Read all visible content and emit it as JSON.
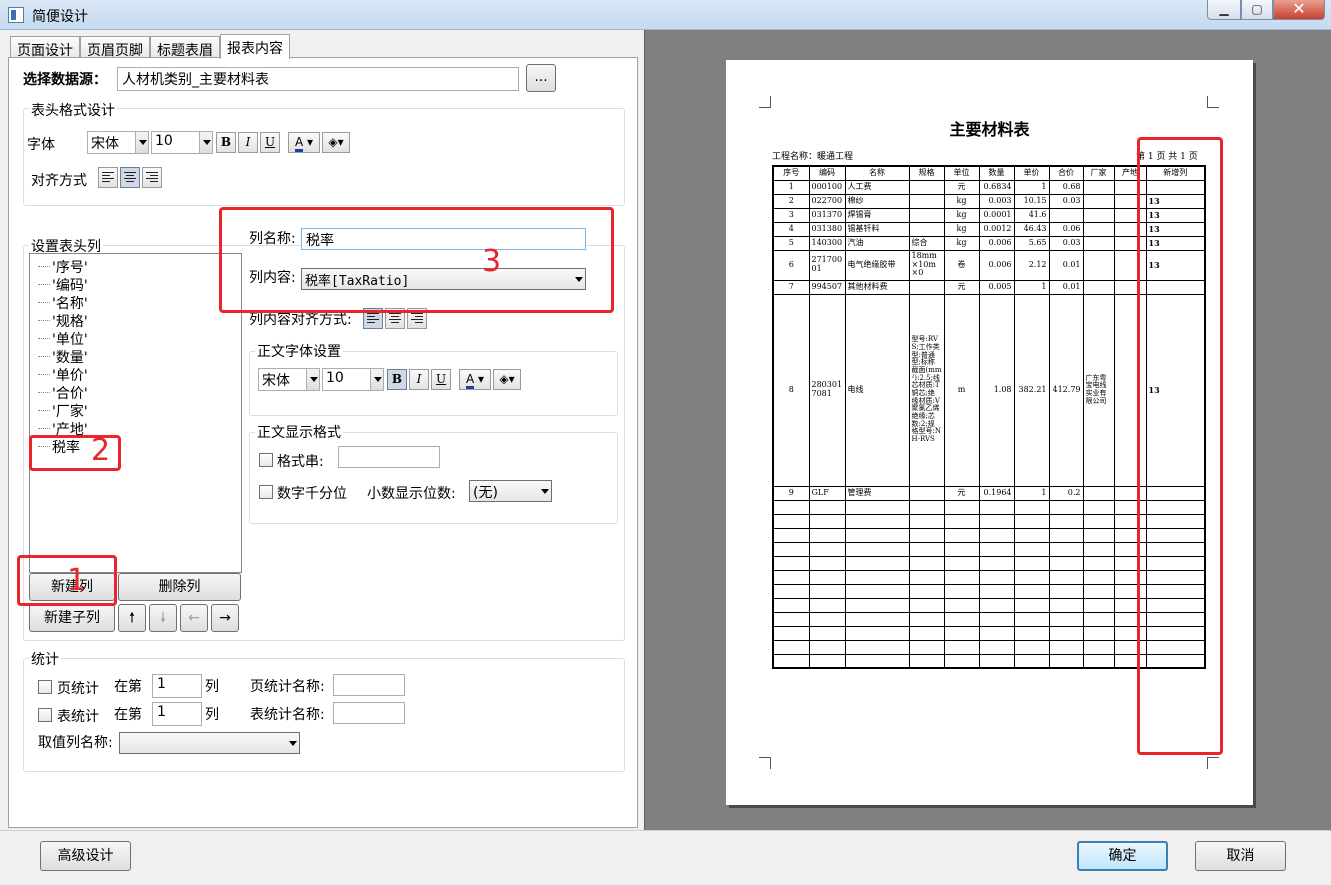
{
  "window": {
    "title": "简便设计",
    "close_glyph": "✕",
    "min_glyph": "▁",
    "max_glyph": "▢"
  },
  "tabs": [
    "页面设计",
    "页眉页脚",
    "标题表眉",
    "报表内容"
  ],
  "datasource": {
    "label": "选择数据源：",
    "value": "人材机类别_主要材料表",
    "browse": "..."
  },
  "header_format": {
    "title": "表头格式设计",
    "font_label": "字体",
    "font": "宋体",
    "size": "10",
    "align_label": "对齐方式"
  },
  "columns": {
    "title": "设置表头列",
    "items": [
      "'序号'",
      "'编码'",
      "'名称'",
      "'规格'",
      "'单位'",
      "'数量'",
      "'单价'",
      "'合价'",
      "'厂家'",
      "'产地'",
      "税率"
    ],
    "new_col": "新建列",
    "delete_col": "删除列",
    "new_sub_col": "新建子列",
    "up": "🠕",
    "down": "🠗",
    "left": "←",
    "right": "→"
  },
  "column_props": {
    "name_label": "列名称:",
    "name_value": "税率",
    "content_label": "列内容:",
    "content_value": "税率[TaxRatio]",
    "align_label": "列内容对齐方式:"
  },
  "body_font": {
    "title": "正文字体设置",
    "font": "宋体",
    "size": "10"
  },
  "body_format": {
    "title": "正文显示格式",
    "fmt_label": "格式串:",
    "thousand_label": "数字千分位",
    "decimals_label": "小数显示位数:",
    "decimals_value": "(无)"
  },
  "stats": {
    "title": "统计",
    "page_stat": "页统计",
    "table_stat": "表统计",
    "at_col": "在第",
    "col_unit": "列",
    "page_col": "1",
    "table_col": "1",
    "page_name_label": "页统计名称:",
    "table_name_label": "表统计名称:",
    "value_col_label": "取值列名称:"
  },
  "annotations": {
    "n1": "1",
    "n2": "2",
    "n3": "3"
  },
  "buttons": {
    "advanced": "高级设计",
    "ok": "确定",
    "cancel": "取消"
  },
  "report": {
    "title": "主要材料表",
    "project": "工程名称：暖通工程",
    "page": "第 1 页  共 1 页",
    "headers": [
      "序号",
      "编码",
      "名称",
      "规格",
      "单位",
      "数量",
      "单价",
      "合价",
      "厂家",
      "产地",
      "新增列"
    ],
    "rows": [
      [
        "1",
        "000100",
        "人工费",
        "",
        "元",
        "0.6834",
        "1",
        "0.68",
        "",
        "",
        ""
      ],
      [
        "2",
        "022700",
        "棉纱",
        "",
        "kg",
        "0.003",
        "10.15",
        "0.03",
        "",
        "",
        "13"
      ],
      [
        "3",
        "031370",
        "焊锡膏",
        "",
        "kg",
        "0.0001",
        "41.6",
        "",
        "",
        "",
        "13"
      ],
      [
        "4",
        "031380",
        "锡基钎料",
        "",
        "kg",
        "0.0012",
        "46.43",
        "0.06",
        "",
        "",
        "13"
      ],
      [
        "5",
        "140300",
        "汽油",
        "综合",
        "kg",
        "0.006",
        "5.65",
        "0.03",
        "",
        "",
        "13"
      ],
      [
        "6",
        "27170001",
        "电气绝缘胶带",
        "18mm×10m×0",
        "卷",
        "0.006",
        "2.12",
        "0.01",
        "",
        "",
        "13"
      ],
      [
        "7",
        "994507",
        "其他材料费",
        "",
        "元",
        "0.005",
        "1",
        "0.01",
        "",
        "",
        ""
      ],
      [
        "8",
        "2803017081",
        "电线",
        "型号:RVS;工作类型:普通型;标称截面(mm²):2.5;线芯材质:T铜芯;绝缘材质:V聚氯乙烯绝缘;芯数:2;规格型号:NH-RVS",
        "m",
        "1.08",
        "382.21",
        "412.79",
        "广东粤宝电线实业有限公司",
        "",
        "13"
      ],
      [
        "9",
        "GLF",
        "管理费",
        "",
        "元",
        "0.1964",
        "1",
        "0.2",
        "",
        "",
        ""
      ]
    ],
    "empty_rows": 12
  }
}
